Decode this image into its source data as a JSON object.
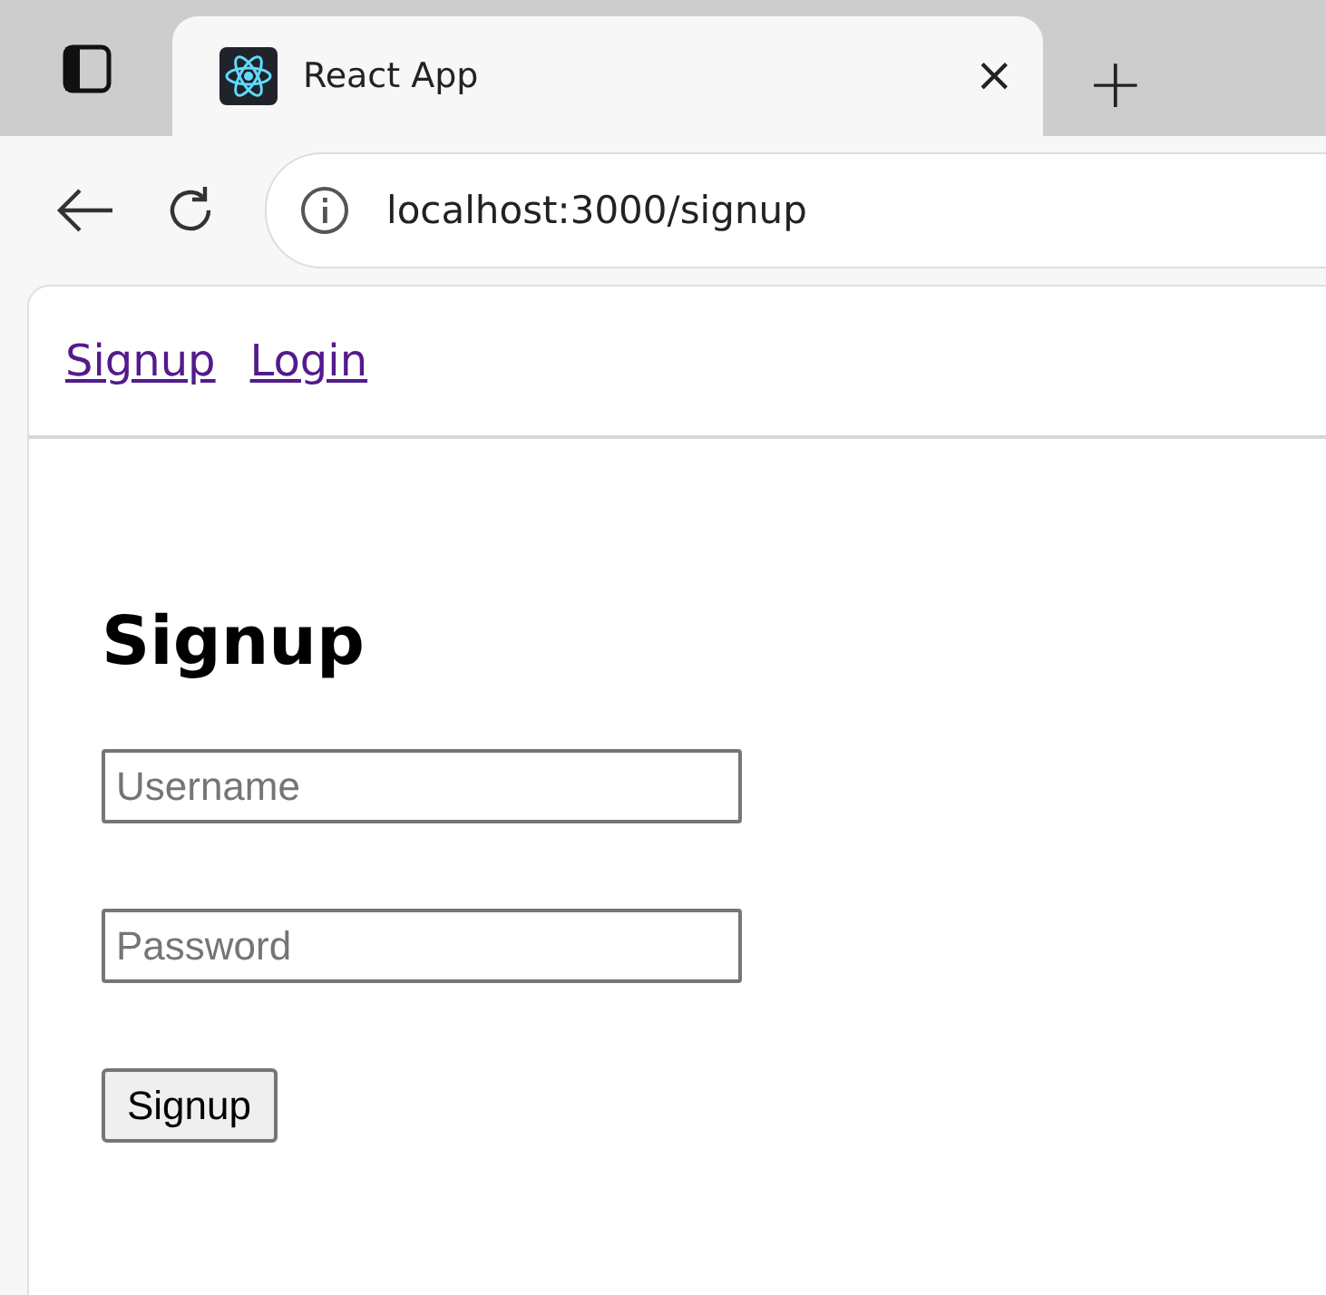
{
  "browser": {
    "tab_title": "React App",
    "close_glyph": "×",
    "new_tab_glyph": "+",
    "url": "localhost:3000/signup"
  },
  "nav": {
    "links": [
      "Signup",
      "Login"
    ]
  },
  "form": {
    "title": "Signup",
    "fields": [
      {
        "placeholder": "Username"
      },
      {
        "placeholder": "Password"
      }
    ],
    "submit": "Signup"
  }
}
